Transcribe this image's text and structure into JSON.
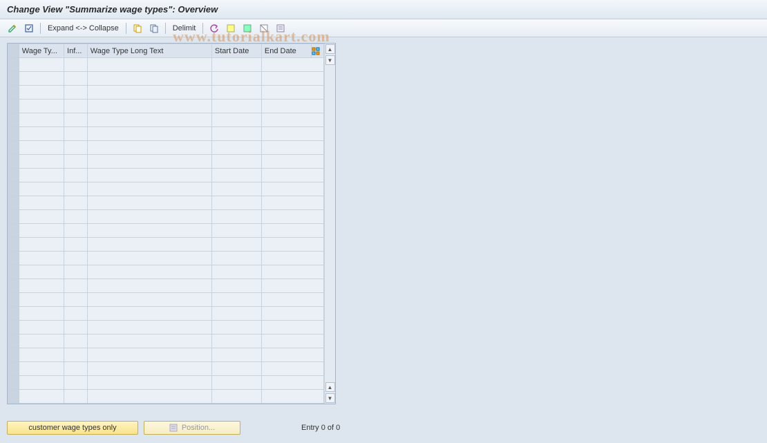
{
  "title": "Change View \"Summarize wage types\": Overview",
  "toolbar": {
    "expand_collapse": "Expand <-> Collapse",
    "delimit": "Delimit"
  },
  "columns": {
    "wage_type": "Wage Ty...",
    "inf": "Inf...",
    "long_text": "Wage Type Long Text",
    "start_date": "Start Date",
    "end_date": "End Date"
  },
  "footer": {
    "customer_btn": "customer wage types only",
    "position_btn": "Position...",
    "entry": "Entry 0 of 0"
  },
  "watermark": "www.tutorialkart.com",
  "row_count": 25
}
